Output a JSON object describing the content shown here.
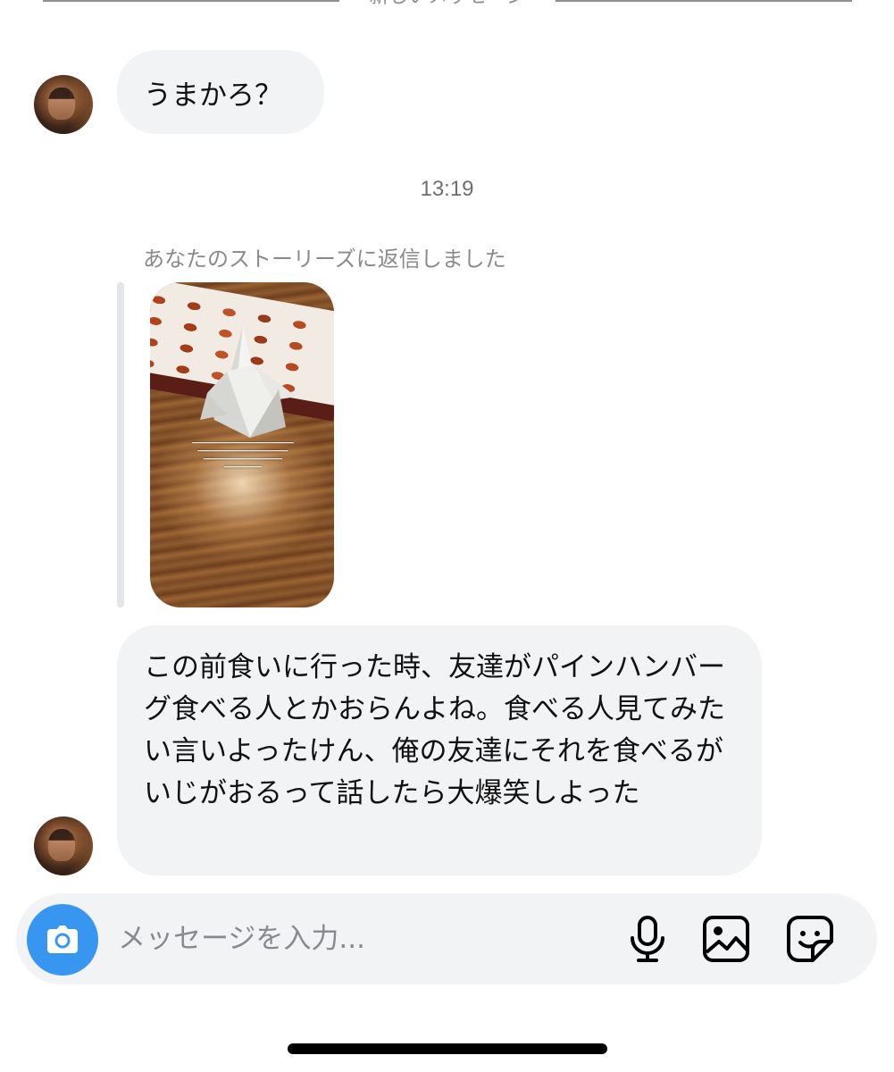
{
  "divider": {
    "label": "新しいメッセージ"
  },
  "messages": [
    {
      "sender": "other",
      "text": "うまかろ？"
    },
    {
      "sender": "other",
      "text": "この前食いに行った時、友達がパインハンバーグ食べる人とかおらんよね。食べる人見てみたい言いよったけん、俺の友達にそれを食べるがいじがおるって話したら大爆笑しよった"
    }
  ],
  "timestamp": "13:19",
  "story_reply": {
    "note": "あなたのストーリーズに返信しました"
  },
  "composer": {
    "placeholder": "メッセージを入力...",
    "value": ""
  },
  "icons": {
    "camera": "camera-icon",
    "mic": "microphone-icon",
    "gallery": "image-gallery-icon",
    "sticker": "sticker-icon"
  },
  "colors": {
    "accent": "#3797f0",
    "bubble": "#f2f3f5",
    "secondary_text": "#8a8a8e"
  }
}
